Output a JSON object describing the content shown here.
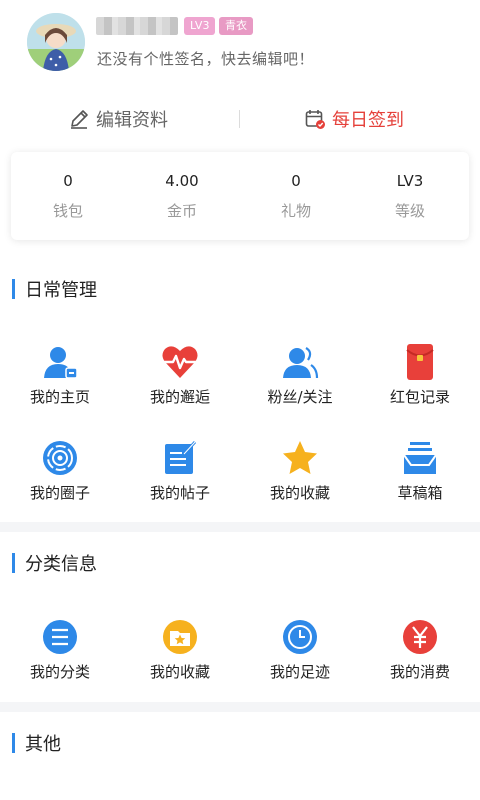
{
  "profile": {
    "badge_level": "LV3",
    "badge_title": "青衣",
    "signature": "还没有个性签名，快去编辑吧！"
  },
  "actions": {
    "edit_label": "编辑资料",
    "checkin_label": "每日签到",
    "checkin_color": "#e5403a"
  },
  "stats": [
    {
      "value": "0",
      "label": "钱包"
    },
    {
      "value": "4.00",
      "label": "金币"
    },
    {
      "value": "0",
      "label": "礼物"
    },
    {
      "value": "LV3",
      "label": "等级"
    }
  ],
  "daily": {
    "title": "日常管理",
    "items": [
      {
        "label": "我的主页",
        "icon": "user-home-icon"
      },
      {
        "label": "我的邂逅",
        "icon": "heartbeat-icon"
      },
      {
        "label": "粉丝/关注",
        "icon": "fans-icon"
      },
      {
        "label": "红包记录",
        "icon": "red-envelope-icon"
      },
      {
        "label": "我的圈子",
        "icon": "circle-target-icon"
      },
      {
        "label": "我的帖子",
        "icon": "post-edit-icon"
      },
      {
        "label": "我的收藏",
        "icon": "star-icon"
      },
      {
        "label": "草稿箱",
        "icon": "drafts-tray-icon"
      }
    ]
  },
  "category": {
    "title": "分类信息",
    "items": [
      {
        "label": "我的分类",
        "icon": "list-icon"
      },
      {
        "label": "我的收藏",
        "icon": "folder-star-icon"
      },
      {
        "label": "我的足迹",
        "icon": "clock-icon"
      },
      {
        "label": "我的消费",
        "icon": "yuan-icon"
      }
    ]
  },
  "other": {
    "title": "其他"
  },
  "accent_color": "#2e89e8"
}
